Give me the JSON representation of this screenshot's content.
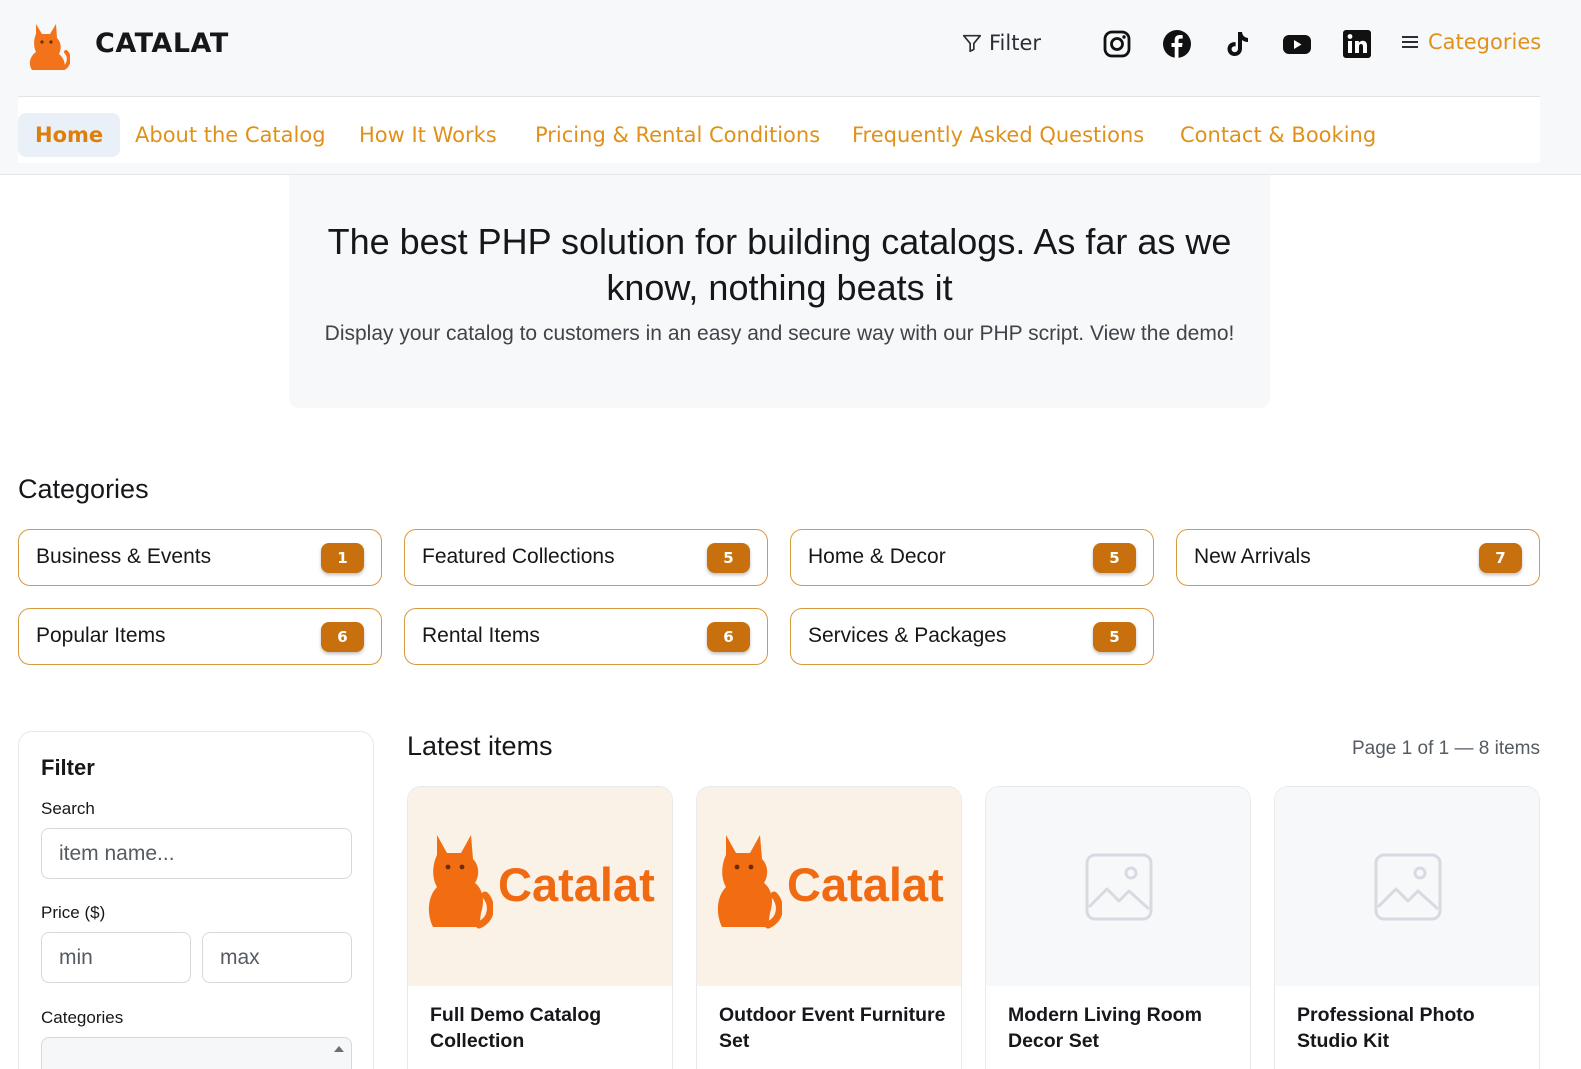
{
  "header": {
    "brand": "CATALAT",
    "filter_label": "Filter",
    "categories_label": "Categories",
    "social": [
      "instagram-icon",
      "facebook-icon",
      "tiktok-icon",
      "youtube-icon",
      "linkedin-icon"
    ]
  },
  "nav": {
    "items": [
      {
        "label": "Home",
        "active": true
      },
      {
        "label": "About the Catalog"
      },
      {
        "label": "How It Works"
      },
      {
        "label": "Pricing & Rental Conditions"
      },
      {
        "label": "Frequently Asked Questions"
      },
      {
        "label": "Contact & Booking"
      }
    ]
  },
  "hero": {
    "title": "The best PHP solution for building catalogs. As far as we know, nothing beats it",
    "subtitle": "Display your catalog to customers in an easy and secure way with our PHP script. View the demo!"
  },
  "categories": {
    "title": "Categories",
    "items": [
      {
        "label": "Business & Events",
        "count": "1"
      },
      {
        "label": "Featured Collections",
        "count": "5"
      },
      {
        "label": "Home & Decor",
        "count": "5"
      },
      {
        "label": "New Arrivals",
        "count": "7"
      },
      {
        "label": "Popular Items",
        "count": "6"
      },
      {
        "label": "Rental Items",
        "count": "6"
      },
      {
        "label": "Services & Packages",
        "count": "5"
      }
    ]
  },
  "filter": {
    "title": "Filter",
    "search_label": "Search",
    "search_placeholder": "item name...",
    "price_label": "Price ($)",
    "min_placeholder": "min",
    "max_placeholder": "max",
    "categories_label": "Categories"
  },
  "latest": {
    "title": "Latest items",
    "page_info": "Page 1 of 1 — 8 items",
    "brand_image_text": "Catalat",
    "items": [
      {
        "name": "Full Demo Catalog Collection",
        "image": "brand-logo"
      },
      {
        "name": "Outdoor Event Furniture Set",
        "image": "brand-logo"
      },
      {
        "name": "Modern Living Room Decor Set",
        "image": "image-placeholder-icon"
      },
      {
        "name": "Professional Photo Studio Kit",
        "image": "image-placeholder-icon"
      }
    ]
  },
  "colors": {
    "accent": "#e0911a",
    "badge": "#c8700e",
    "brand_orange": "#f06a12"
  }
}
